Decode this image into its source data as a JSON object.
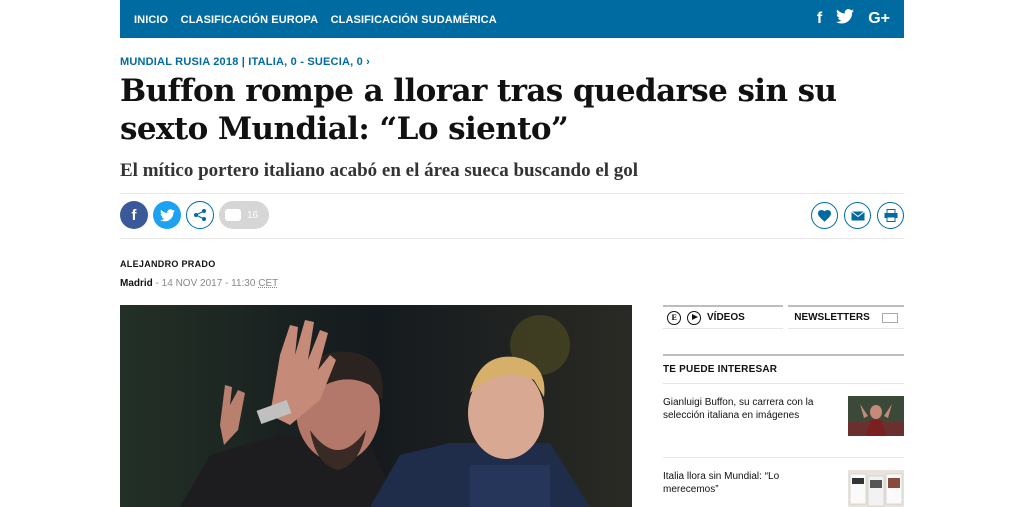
{
  "nav": {
    "links": [
      "INICIO",
      "CLASIFICACIÓN EUROPA",
      "CLASIFICACIÓN SUDAMÉRICA"
    ],
    "social": [
      "facebook-icon",
      "twitter-icon",
      "google-plus-icon"
    ]
  },
  "article": {
    "kicker": "MUNDIAL RUSIA 2018 | ITALIA, 0 - SUECIA, 0 ›",
    "headline": "Buffon rompe a llorar tras quedarse sin su sexto Mundial: “Lo siento”",
    "subhead": "El mítico portero italiano acabó en el área sueca buscando el gol",
    "comments_count": "16",
    "author": "ALEJANDRO PRADO",
    "city": "Madrid",
    "date": " - 14 NOV 2017 - 11:30 ",
    "timezone": "CET"
  },
  "sidebar": {
    "tab_videos": "VÍDEOS",
    "tab_newsletters": "NEWSLETTERS",
    "related_title": "TE PUEDE INTERESAR",
    "items": [
      {
        "text": "Gianluigi Buffon, su carrera con la selección italiana en imágenes"
      },
      {
        "text": "Italia llora sin Mundial: “Lo merecemos”"
      }
    ]
  },
  "colors": {
    "brand": "#006ba1",
    "facebook": "#3b5998",
    "twitter": "#1da1f2"
  }
}
